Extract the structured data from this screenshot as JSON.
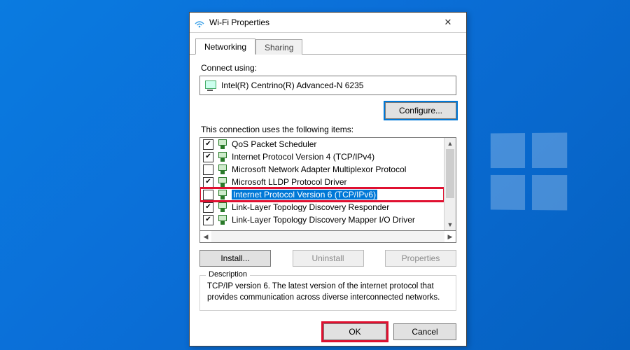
{
  "window": {
    "title": "Wi-Fi Properties"
  },
  "tabs": {
    "networking": "Networking",
    "sharing": "Sharing",
    "active": "networking"
  },
  "connect": {
    "label": "Connect using:",
    "adapter": "Intel(R) Centrino(R) Advanced-N 6235",
    "configure": "Configure..."
  },
  "items": {
    "label": "This connection uses the following items:",
    "list": [
      {
        "checked": true,
        "label": "QoS Packet Scheduler",
        "selected": false,
        "highlighted": false
      },
      {
        "checked": true,
        "label": "Internet Protocol Version 4 (TCP/IPv4)",
        "selected": false,
        "highlighted": false
      },
      {
        "checked": false,
        "label": "Microsoft Network Adapter Multiplexor Protocol",
        "selected": false,
        "highlighted": false
      },
      {
        "checked": true,
        "label": "Microsoft LLDP Protocol Driver",
        "selected": false,
        "highlighted": false
      },
      {
        "checked": false,
        "label": "Internet Protocol Version 6 (TCP/IPv6)",
        "selected": true,
        "highlighted": true
      },
      {
        "checked": true,
        "label": "Link-Layer Topology Discovery Responder",
        "selected": false,
        "highlighted": false
      },
      {
        "checked": true,
        "label": "Link-Layer Topology Discovery Mapper I/O Driver",
        "selected": false,
        "highlighted": false
      }
    ]
  },
  "buttons": {
    "install": "Install...",
    "uninstall": "Uninstall",
    "properties": "Properties"
  },
  "description": {
    "title": "Description",
    "text": "TCP/IP version 6. The latest version of the internet protocol that provides communication across diverse interconnected networks."
  },
  "footer": {
    "ok": "OK",
    "cancel": "Cancel"
  }
}
